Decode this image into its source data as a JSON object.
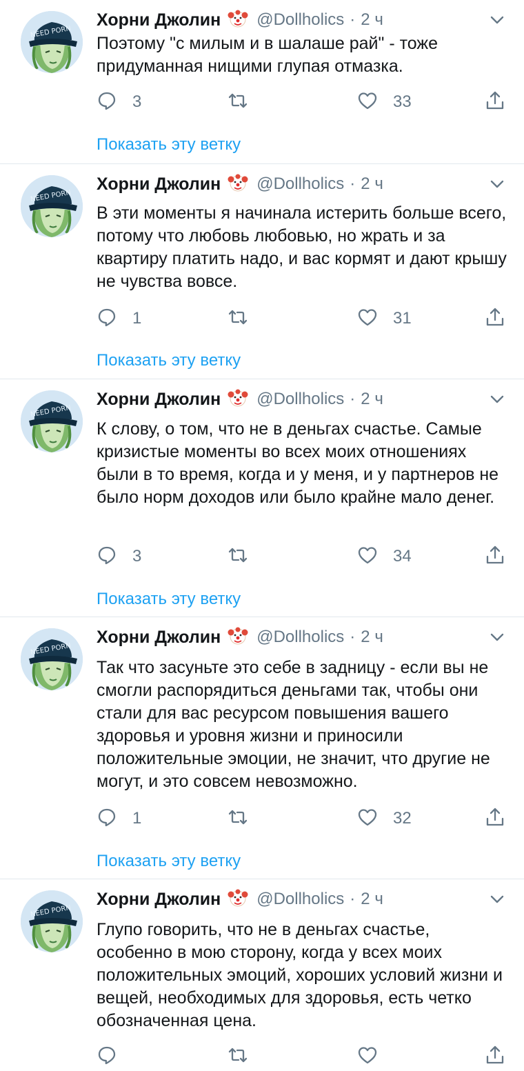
{
  "tweets": [
    {
      "name": "Хорни Джолин",
      "handle": "@Dollholics",
      "sep": "·",
      "time": "2 ч",
      "text": "Поэтому \"с милым и в шалаше рай\" - тоже придуманная нищими глупая отмазка.",
      "replies": "3",
      "retweets": "",
      "likes": "33",
      "show_thread": "Показать эту ветку"
    },
    {
      "name": "Хорни Джолин",
      "handle": "@Dollholics",
      "sep": "·",
      "time": "2 ч",
      "text": "В эти моменты я начинала истерить больше всего,  потому что любовь любовью, но жрать и за квартиру платить надо, и вас кормят и дают крышу не чувства вовсе.",
      "replies": "1",
      "retweets": "",
      "likes": "31",
      "show_thread": "Показать эту ветку"
    },
    {
      "name": "Хорни Джолин",
      "handle": "@Dollholics",
      "sep": "·",
      "time": "2 ч",
      "text": "К слову,  о том,  что не в деньгах счастье. Самые кризистые моменты во всех моих отношениях были в то время, когда и у меня, и у партнеров не было норм доходов или было крайне мало денег.",
      "replies": "3",
      "retweets": "",
      "likes": "34",
      "show_thread": "Показать эту ветку"
    },
    {
      "name": "Хорни Джолин",
      "handle": "@Dollholics",
      "sep": "·",
      "time": "2 ч",
      "text": "Так что засуньте это себе в задницу - если вы не смогли распорядиться деньгами так, чтобы они стали для вас ресурсом повышения вашего здоровья и уровня жизни и приносили положительные эмоции,  не значит, что другие не могут,  и это совсем невозможно.",
      "replies": "1",
      "retweets": "",
      "likes": "32",
      "show_thread": "Показать эту ветку"
    },
    {
      "name": "Хорни Джолин",
      "handle": "@Dollholics",
      "sep": "·",
      "time": "2 ч",
      "text": "Глупо говорить, что не в деньгах счастье, особенно в мою сторону, когда у всех моих положительных эмоций, хороших условий жизни и вещей, необходимых для здоровья, есть четко обозначенная цена.",
      "replies": "",
      "retweets": "",
      "likes": "",
      "show_thread": ""
    }
  ],
  "avatar_cap_text": "NEED PORN",
  "colors": {
    "accent": "#1da1f2",
    "secondary_text": "#657786",
    "divider": "#e1e8ed"
  },
  "icons": [
    "clown-face-emoji",
    "chevron-down-icon",
    "reply-icon",
    "retweet-icon",
    "like-icon",
    "share-icon"
  ]
}
